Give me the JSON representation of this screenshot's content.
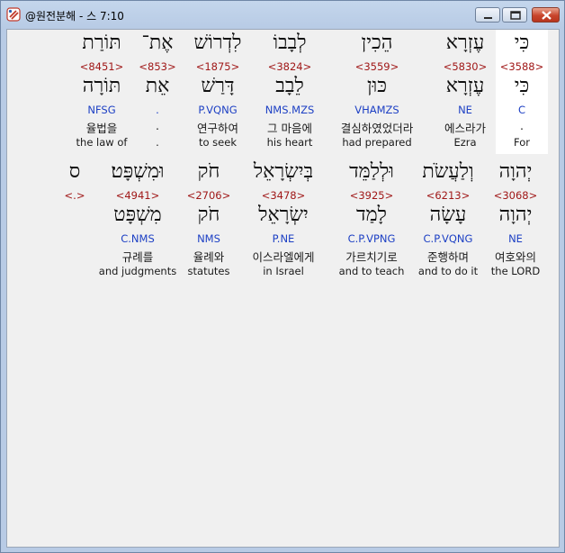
{
  "window": {
    "title": "@원전분해 - 스 7:10",
    "minimize_label": "minimize",
    "maximize_label": "maximize",
    "close_label": "close"
  },
  "verse": {
    "row1": [
      {
        "hebrew": "כִּי",
        "strongs": "<3588>",
        "lemma": "כִּי",
        "parsing": "C",
        "korean": ".",
        "english": "For",
        "selected": true
      },
      {
        "hebrew": "עֶזְרָא",
        "strongs": "<5830>",
        "lemma": "עֶזְרָא",
        "parsing": "NE",
        "korean": "에스라가",
        "english": "Ezra",
        "selected": false
      },
      {
        "hebrew": "הֵכִין",
        "strongs": "<3559>",
        "lemma": "כּוּן",
        "parsing": "VHAMZS",
        "korean": "결심하였었더라",
        "english": "had prepared",
        "selected": false
      },
      {
        "hebrew": "לְבָבוֹ",
        "strongs": "<3824>",
        "lemma": "לֵבָב",
        "parsing": "NMS.MZS",
        "korean": "그 마음에",
        "english": "his heart",
        "selected": false
      },
      {
        "hebrew": "לִדְרוֹשׁ",
        "strongs": "<1875>",
        "lemma": "דָּרַשׁ",
        "parsing": "P.VQNG",
        "korean": "연구하여",
        "english": "to seek",
        "selected": false
      },
      {
        "hebrew": "אֶת־",
        "strongs": "<853>",
        "lemma": "אֵת",
        "parsing": ".",
        "korean": ".",
        "english": ".",
        "selected": false
      },
      {
        "hebrew": "תּוֹרַת",
        "strongs": "<8451>",
        "lemma": "תּוֹרָה",
        "parsing": "NFSG",
        "korean": "율법을",
        "english": "the law of",
        "selected": false
      }
    ],
    "row2": [
      {
        "hebrew": "יְהוָה",
        "strongs": "<3068>",
        "lemma": "יְהוָה",
        "parsing": "NE",
        "korean": "여호와의",
        "english": "the LORD"
      },
      {
        "hebrew": "וְלַעֲשֹׂת",
        "strongs": "<6213>",
        "lemma": "עָשָׂה",
        "parsing": "C.P.VQNG",
        "korean": "준행하며",
        "english": "and to do it"
      },
      {
        "hebrew": "וּלְלַמֵּד",
        "strongs": "<3925>",
        "lemma": "לָמַד",
        "parsing": "C.P.VPNG",
        "korean": "가르치기로",
        "english": "and  to teach"
      },
      {
        "hebrew": "בְּיִשְׂרָאֵל",
        "strongs": "<3478>",
        "lemma": "יִשְׂרָאֵל",
        "parsing": "P.NE",
        "korean": "이스라엘에게",
        "english": "in Israel"
      },
      {
        "hebrew": "חֹק",
        "strongs": "<2706>",
        "lemma": "חֹק",
        "parsing": "NMS",
        "korean": "율례와",
        "english": "statutes"
      },
      {
        "hebrew": "וּמִשְׁפָּט׃",
        "strongs": "<4941>",
        "lemma": "מִשְׁפָּט",
        "parsing": "C.NMS",
        "korean": "규례를",
        "english": "and judgments"
      },
      {
        "hebrew": "ס",
        "strongs": "<.>",
        "lemma": "",
        "parsing": "",
        "korean": "",
        "english": ""
      }
    ]
  },
  "colors": {
    "strongs": "#a01818",
    "parsing": "#1c3fc4",
    "selected_bg": "#ffffff",
    "client_bg": "#f0f0f0"
  }
}
